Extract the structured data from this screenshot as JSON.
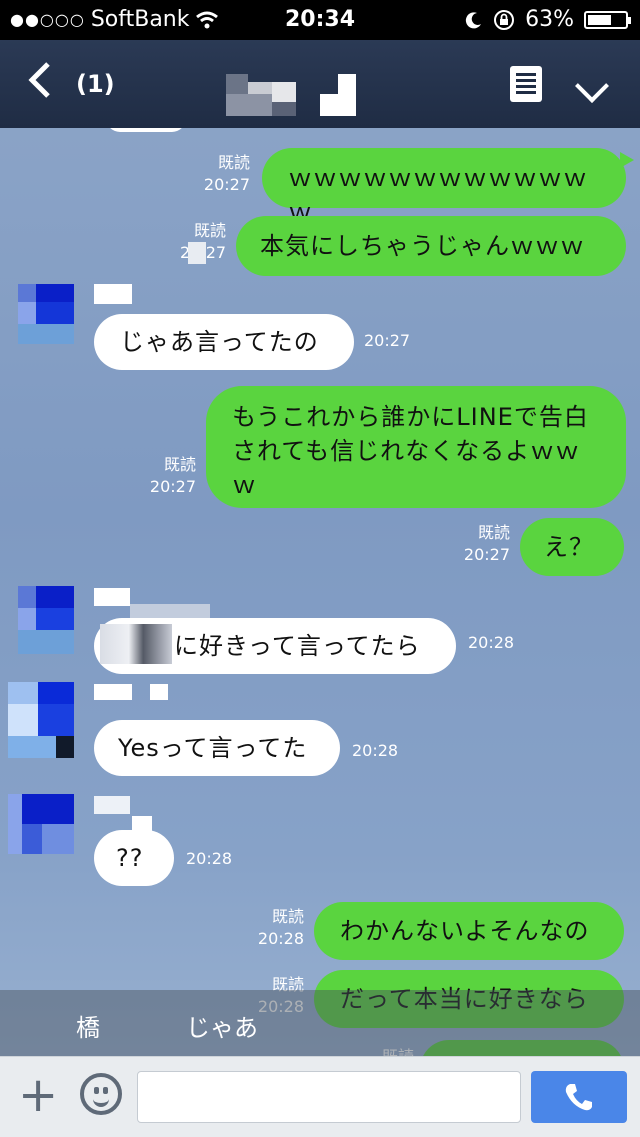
{
  "status": {
    "signal": "●●○○○",
    "carrier": "SoftBank",
    "time": "20:34",
    "battery": "63%",
    "battery_level": 0.63
  },
  "header": {
    "back_icon": "chevron-left-icon",
    "unread_count": "(1)",
    "menu_icon": "list-icon",
    "dropdown_icon": "chevron-down-icon"
  },
  "messages": [
    {
      "dir": "out",
      "read": "既読",
      "time": "20:27",
      "text": "ｗｗｗｗｗｗｗｗｗｗｗｗｗ"
    },
    {
      "dir": "out",
      "read": "既読",
      "time": "20:27",
      "text": "本気にしちゃうじゃんｗｗｗ"
    },
    {
      "dir": "in",
      "time": "20:27",
      "text": "じゃあ言ってたの"
    },
    {
      "dir": "out",
      "read": "既読",
      "time": "20:27",
      "text": "もうこれから誰かにLINEで告白されても信じれなくなるよｗｗｗ"
    },
    {
      "dir": "out",
      "read": "既読",
      "time": "20:27",
      "text": "え？"
    },
    {
      "dir": "in",
      "time": "20:28",
      "text": "に好きって言ってたら"
    },
    {
      "dir": "in",
      "time": "20:28",
      "text": "Yesって言ってた"
    },
    {
      "dir": "in",
      "time": "20:28",
      "text": "??"
    },
    {
      "dir": "out",
      "read": "既読",
      "time": "20:28",
      "text": "わかんないよそんなの"
    },
    {
      "dir": "out",
      "read": "既読",
      "time": "20:28",
      "text": "だって本当に好きなら"
    },
    {
      "dir": "out",
      "read": "既読",
      "time": "",
      "text": ""
    }
  ],
  "suggestions": [
    "橋",
    "じゃあ"
  ],
  "input": {
    "placeholder": "",
    "plus_icon": "plus-icon",
    "emoji_icon": "smiley-icon",
    "call_icon": "phone-icon"
  },
  "colors": {
    "outgoing_bubble": "#5ad43f",
    "incoming_bubble": "#ffffff",
    "nav_bg": "#1f2c44",
    "call_button": "#4a86e8"
  }
}
